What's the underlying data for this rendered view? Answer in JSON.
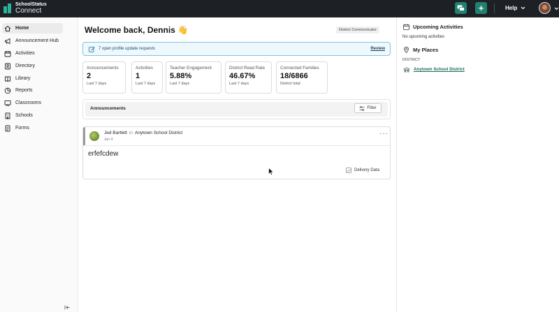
{
  "app": {
    "brand_line1": "SchoolStatus",
    "brand_line2": "Connect",
    "help_label": "Help",
    "accent_color": "#21806f"
  },
  "sidebar": {
    "items": [
      {
        "label": "Home",
        "icon": "home-icon",
        "active": true
      },
      {
        "label": "Announcement Hub",
        "icon": "megaphone-icon"
      },
      {
        "label": "Activities",
        "icon": "calendar-icon"
      },
      {
        "label": "Directory",
        "icon": "contacts-icon"
      },
      {
        "label": "Library",
        "icon": "book-icon"
      },
      {
        "label": "Reports",
        "icon": "chart-icon"
      },
      {
        "label": "Classrooms",
        "icon": "whiteboard-icon"
      },
      {
        "label": "Schools",
        "icon": "building-icon"
      },
      {
        "label": "Forms",
        "icon": "form-icon"
      }
    ]
  },
  "main": {
    "welcome": "Welcome back, Dennis",
    "wave": "👋",
    "role_badge": "District Communicator",
    "alert": {
      "text": "7 open profile update requests",
      "action": "Review"
    },
    "stats": [
      {
        "label": "Announcements",
        "value": "2",
        "sub": "Last 7 days"
      },
      {
        "label": "Activities",
        "value": "1",
        "sub": "Last 7 days"
      },
      {
        "label": "Teacher Engagement",
        "value": "5.88%",
        "sub": "Last 7 days"
      },
      {
        "label": "District Read Rate",
        "value": "46.67%",
        "sub": "Last 7 days"
      },
      {
        "label": "Connected Families",
        "value": "18/6866",
        "sub": "District total"
      }
    ],
    "announcements": {
      "title": "Announcements",
      "filter_label": "Filter"
    },
    "post": {
      "author": "Jed Bartlett",
      "in_word": "in",
      "district": "Anytown School District",
      "date": "Jun 4",
      "body": "erfefcdew",
      "delivery_label": "Delivery Data"
    }
  },
  "right_panel": {
    "upcoming_title": "Upcoming Activities",
    "upcoming_empty": "No upcoming activities",
    "places_title": "My Places",
    "district_label": "DISTRICT",
    "district_link": "Anytown School District"
  }
}
